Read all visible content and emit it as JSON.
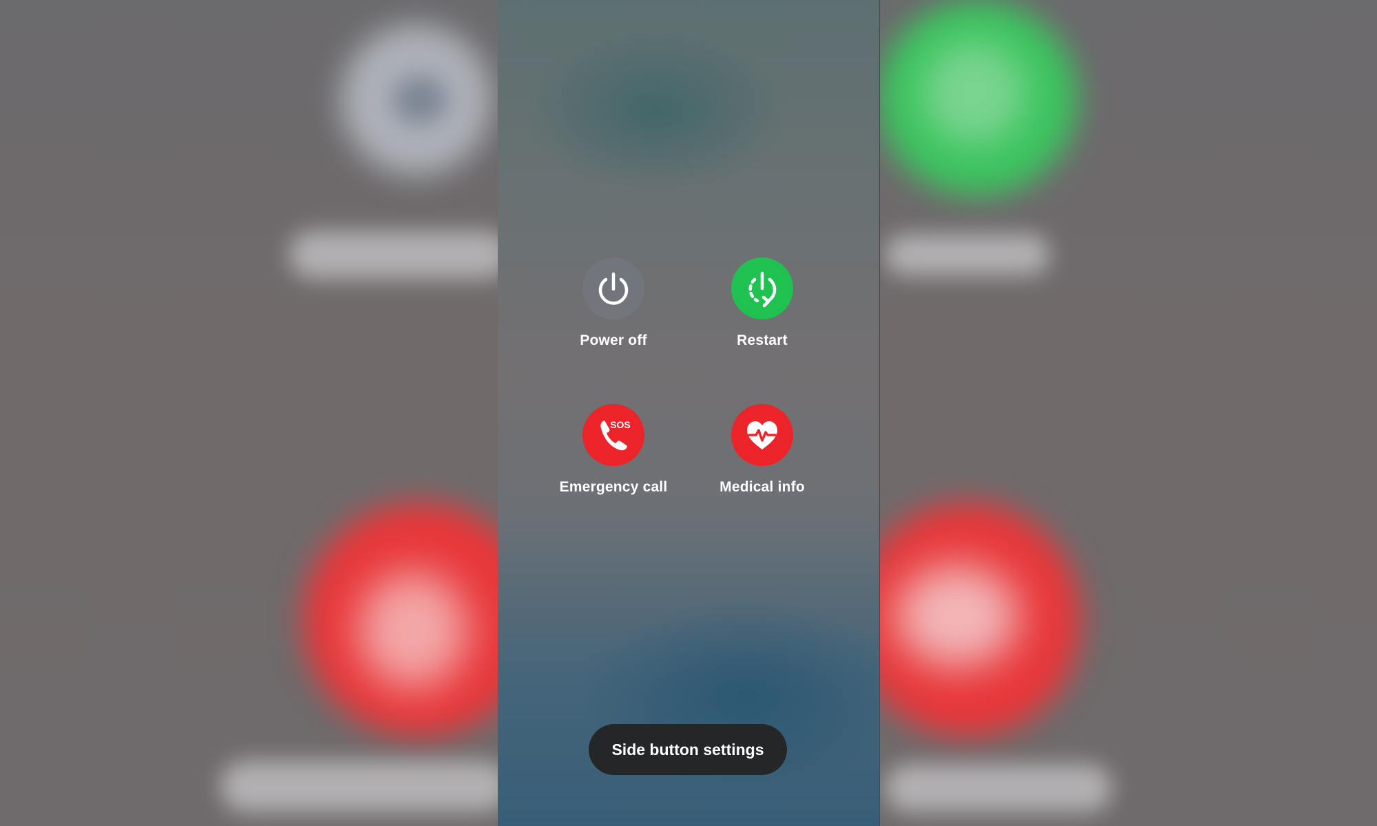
{
  "menu": {
    "power_off": {
      "label": "Power off",
      "icon": "power-icon",
      "color": "#7a808c"
    },
    "restart": {
      "label": "Restart",
      "icon": "restart-icon",
      "color": "#1fc251"
    },
    "emergency_call": {
      "label": "Emergency call",
      "icon": "sos-phone-icon",
      "badge": "SOS",
      "color": "#ec2328"
    },
    "medical_info": {
      "label": "Medical info",
      "icon": "heart-pulse-icon",
      "color": "#ec2328"
    }
  },
  "footer": {
    "side_button_label": "Side button settings"
  }
}
